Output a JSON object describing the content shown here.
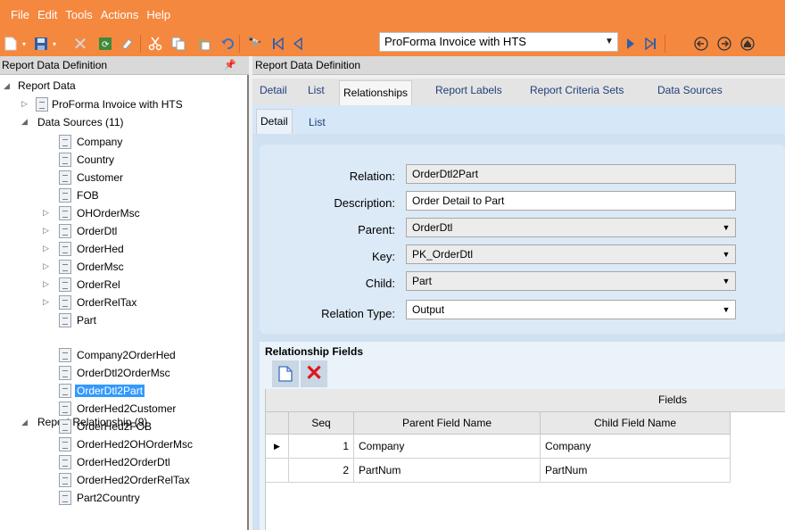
{
  "menu": {
    "items": [
      "File",
      "Edit",
      "Tools",
      "Actions",
      "Help"
    ]
  },
  "toolbar": {
    "report_selector": {
      "value": "ProForma Invoice with HTS"
    }
  },
  "left_panel": {
    "header": "Report Data Definition",
    "tree": {
      "root": "Report Data",
      "report": "ProForma Invoice with HTS",
      "data_sources": {
        "label": "Data Sources (11)",
        "items": [
          "Company",
          "Country",
          "Customer",
          "FOB",
          "OHOrderMsc",
          "OrderDtl",
          "OrderHed",
          "OrderMsc",
          "OrderRel",
          "OrderRelTax",
          "Part"
        ]
      },
      "relationships": {
        "label": "Report Relationship (9)",
        "items": [
          "Company2OrderHed",
          "OrderDtl2OrderMsc",
          "OrderDtl2Part",
          "OrderHed2Customer",
          "OrderHed2FOB",
          "OrderHed2OHOrderMsc",
          "OrderHed2OrderDtl",
          "OrderHed2OrderRelTax",
          "Part2Country"
        ]
      }
    }
  },
  "right_panel": {
    "header": "Report Data Definition",
    "tabs": [
      "Detail",
      "List",
      "Relationships",
      "Report Labels",
      "Report Criteria Sets",
      "Data Sources"
    ],
    "subtabs": [
      "Detail",
      "List"
    ],
    "form": {
      "relation": {
        "label": "Relation:",
        "value": "OrderDtl2Part"
      },
      "description": {
        "label": "Description:",
        "value": "Order Detail to Part"
      },
      "parent": {
        "label": "Parent:",
        "value": "OrderDtl"
      },
      "key": {
        "label": "Key:",
        "value": "PK_OrderDtl"
      },
      "child": {
        "label": "Child:",
        "value": "Part"
      },
      "relation_type": {
        "label": "Relation Type:",
        "value": "Output"
      }
    },
    "relationship_fields": {
      "title": "Relationship Fields",
      "group_header": "Fields",
      "columns": [
        "Seq",
        "Parent Field Name",
        "Child Field Name"
      ],
      "rows": [
        {
          "seq": "1",
          "parent": "Company",
          "child": "Company"
        },
        {
          "seq": "2",
          "parent": "PartNum",
          "child": "PartNum"
        }
      ]
    }
  },
  "colors": {
    "accent": "#f5883f",
    "selection": "#3399ff",
    "panel": "#d0e1f2",
    "delete": "#e0161c"
  }
}
